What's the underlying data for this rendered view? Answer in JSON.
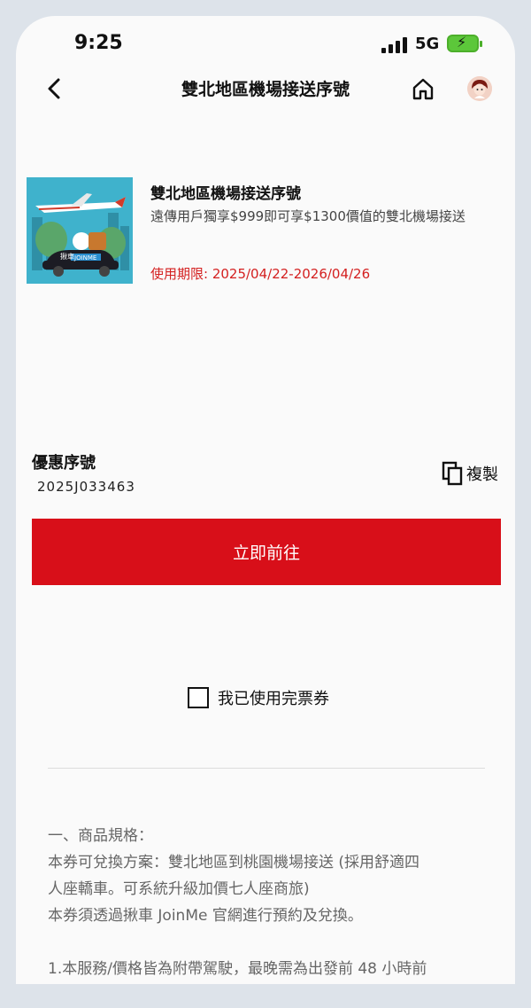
{
  "status_bar": {
    "time": "9:25",
    "network": "5G",
    "battery_color": "#5cc73a"
  },
  "nav": {
    "title": "雙北地區機場接送序號"
  },
  "product": {
    "title": "雙北地區機場接送序號",
    "description": "遠傳用戶獨享$999即可享$1300價值的雙北機場接送",
    "validity": "使用期限: 2025/04/22-2026/04/26",
    "image_text": {
      "brand_cn": "揪車",
      "brand_en": "JOINME"
    }
  },
  "coupon": {
    "label": "優惠序號",
    "code": "2025J033463",
    "copy_label": "複製"
  },
  "go_button": {
    "label": "立即前往",
    "color": "#d80f19"
  },
  "used_checkbox": {
    "label": "我已使用完票券",
    "checked": false
  },
  "details": {
    "lines": [
      "一、商品規格：",
      "本券可兌換方案：雙北地區到桃園機場接送 (採用舒適四",
      "人座轎車。可系統升級加價七人座商旅)",
      "本券須透過揪車 JoinMe 官網進行預約及兌換。",
      "",
      "1.本服務/價格皆為附帶駕駛，最晚需為出發前 48 小時前"
    ]
  },
  "colors": {
    "accent_red": "#d42020",
    "background": "#fafafa"
  }
}
